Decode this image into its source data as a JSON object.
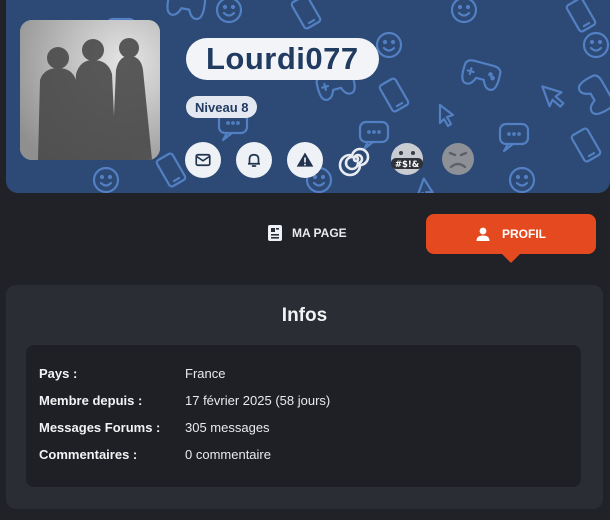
{
  "profile": {
    "username": "Lourdi077",
    "level": "Niveau 8",
    "badges": [
      "spiral-badge",
      "censored-swear-badge",
      "sad-face-badge"
    ]
  },
  "actions": [
    {
      "name": "message-button",
      "icon": "envelope-icon"
    },
    {
      "name": "notification-button",
      "icon": "bell-icon"
    },
    {
      "name": "report-button",
      "icon": "warning-icon"
    }
  ],
  "tabs": {
    "page_label": "MA PAGE",
    "profil_label": "PROFIL"
  },
  "infos": {
    "title": "Infos",
    "rows": [
      {
        "label": "Pays :",
        "value": "France"
      },
      {
        "label": "Membre depuis :",
        "value": "17 février 2025 (58 jours)"
      },
      {
        "label": "Messages Forums :",
        "value": "305 messages"
      },
      {
        "label": "Commentaires :",
        "value": "0 commentaire"
      }
    ]
  },
  "colors": {
    "banner": "#2c4a75",
    "accent": "#e4491f",
    "page_background": "#202227",
    "card": "#2a2d34"
  }
}
